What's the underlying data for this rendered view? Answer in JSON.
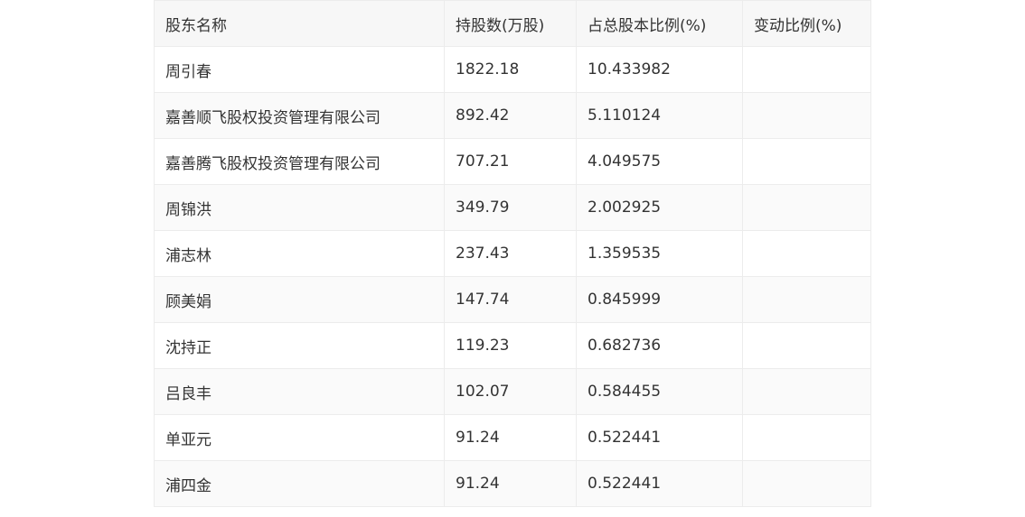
{
  "table": {
    "headers": [
      "股东名称",
      "持股数(万股)",
      "占总股本比例(%)",
      "变动比例(%)"
    ],
    "rows": [
      [
        "周引春",
        "1822.18",
        "10.433982",
        ""
      ],
      [
        "嘉善顺飞股权投资管理有限公司",
        "892.42",
        "5.110124",
        ""
      ],
      [
        "嘉善腾飞股权投资管理有限公司",
        "707.21",
        "4.049575",
        ""
      ],
      [
        "周锦洪",
        "349.79",
        "2.002925",
        ""
      ],
      [
        "浦志林",
        "237.43",
        "1.359535",
        ""
      ],
      [
        "顾美娟",
        "147.74",
        "0.845999",
        ""
      ],
      [
        "沈持正",
        "119.23",
        "0.682736",
        ""
      ],
      [
        "吕良丰",
        "102.07",
        "0.584455",
        ""
      ],
      [
        "单亚元",
        "91.24",
        "0.522441",
        ""
      ],
      [
        "浦四金",
        "91.24",
        "0.522441",
        ""
      ]
    ]
  }
}
